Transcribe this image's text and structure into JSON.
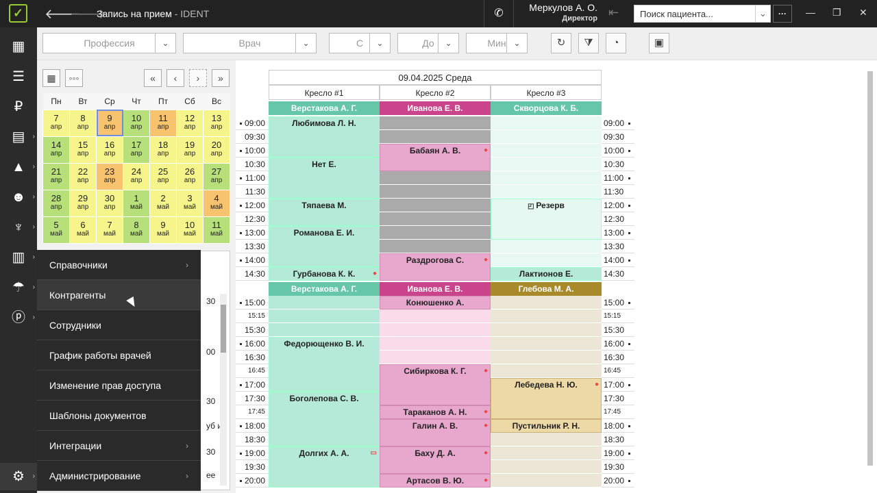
{
  "app": {
    "title": "Запись на прием",
    "subtitle": " - IDENT",
    "user_name": "Меркулов А. О.",
    "user_role": "Директор",
    "search_placeholder": "Поиск пациента...",
    "logo": "check-icon",
    "accent": "#99cc33"
  },
  "toolbar": {
    "profession": "Профессия",
    "doctor": "Врач",
    "from": "С",
    "to": "До",
    "min": "Мин"
  },
  "calendar": {
    "weekdays": [
      "Пн",
      "Вт",
      "Ср",
      "Чт",
      "Пт",
      "Сб",
      "Вс"
    ],
    "weeks": [
      [
        {
          "d": "7",
          "m": "апр",
          "c": "y"
        },
        {
          "d": "8",
          "m": "апр",
          "c": "y"
        },
        {
          "d": "9",
          "m": "апр",
          "c": "o",
          "sel": true
        },
        {
          "d": "10",
          "m": "апр",
          "c": "g"
        },
        {
          "d": "11",
          "m": "апр",
          "c": "o"
        },
        {
          "d": "12",
          "m": "апр",
          "c": "y"
        },
        {
          "d": "13",
          "m": "апр",
          "c": "y"
        }
      ],
      [
        {
          "d": "14",
          "m": "апр",
          "c": "g"
        },
        {
          "d": "15",
          "m": "апр",
          "c": "y"
        },
        {
          "d": "16",
          "m": "апр",
          "c": "y"
        },
        {
          "d": "17",
          "m": "апр",
          "c": "g"
        },
        {
          "d": "18",
          "m": "апр",
          "c": "y"
        },
        {
          "d": "19",
          "m": "апр",
          "c": "y"
        },
        {
          "d": "20",
          "m": "апр",
          "c": "y"
        }
      ],
      [
        {
          "d": "21",
          "m": "апр",
          "c": "g"
        },
        {
          "d": "22",
          "m": "апр",
          "c": "y"
        },
        {
          "d": "23",
          "m": "апр",
          "c": "o"
        },
        {
          "d": "24",
          "m": "апр",
          "c": "y"
        },
        {
          "d": "25",
          "m": "апр",
          "c": "y"
        },
        {
          "d": "26",
          "m": "апр",
          "c": "y"
        },
        {
          "d": "27",
          "m": "апр",
          "c": "g"
        }
      ],
      [
        {
          "d": "28",
          "m": "апр",
          "c": "g"
        },
        {
          "d": "29",
          "m": "апр",
          "c": "y"
        },
        {
          "d": "30",
          "m": "апр",
          "c": "y"
        },
        {
          "d": "1",
          "m": "май",
          "c": "g"
        },
        {
          "d": "2",
          "m": "май",
          "c": "y"
        },
        {
          "d": "3",
          "m": "май",
          "c": "y"
        },
        {
          "d": "4",
          "m": "май",
          "c": "o"
        }
      ],
      [
        {
          "d": "5",
          "m": "май",
          "c": "g"
        },
        {
          "d": "6",
          "m": "май",
          "c": "y"
        },
        {
          "d": "7",
          "m": "май",
          "c": "y"
        },
        {
          "d": "8",
          "m": "май",
          "c": "g"
        },
        {
          "d": "9",
          "m": "май",
          "c": "y"
        },
        {
          "d": "10",
          "m": "май",
          "c": "y"
        },
        {
          "d": "11",
          "m": "май",
          "c": "g"
        }
      ]
    ]
  },
  "side_list": {
    "times": [
      "30",
      "00",
      "30",
      "30"
    ],
    "fragments": [
      "уб и",
      "ее"
    ]
  },
  "menu": [
    {
      "label": "Справочники",
      "sub": true
    },
    {
      "label": "Контрагенты",
      "sub": false,
      "hover": true
    },
    {
      "label": "Сотрудники",
      "sub": false
    },
    {
      "label": "График работы врачей",
      "sub": false
    },
    {
      "label": "Изменение прав доступа",
      "sub": false
    },
    {
      "label": "Шаблоны документов",
      "sub": false
    },
    {
      "label": "Интеграции",
      "sub": true
    },
    {
      "label": "Администрирование",
      "sub": true
    }
  ],
  "schedule": {
    "date": "09.04.2025 Среда",
    "chairs": [
      "Кресло #1",
      "Кресло #2",
      "Кресло #3"
    ],
    "times_top": [
      "09:00",
      "09:30",
      "10:00",
      "10:30",
      "11:00",
      "11:30",
      "12:00",
      "12:30",
      "13:00",
      "13:30",
      "14:00",
      "14:30"
    ],
    "times_bottom": [
      "15:00",
      "15:15",
      "15:30",
      "16:00",
      "16:30",
      "16:45",
      "17:00",
      "17:30",
      "17:45",
      "18:00",
      "18:30",
      "19:00",
      "19:30",
      "20:00"
    ],
    "doctors_top": [
      {
        "name": "Верстакова А. Г.",
        "color": "#66c7a8"
      },
      {
        "name": "Иванова Е. В.",
        "color": "#c9448a"
      },
      {
        "name": "Скворцова К. Б.",
        "color": "#66c7a8"
      }
    ],
    "doctors_bottom": [
      {
        "name": "Верстакова А. Г.",
        "color": "#66c7a8"
      },
      {
        "name": "Иванова Е. В.",
        "color": "#c9448a"
      },
      {
        "name": "Глебова М. А.",
        "color": "#a88a2a"
      }
    ],
    "appointments": [
      {
        "col": 0,
        "part": "top",
        "start": 0,
        "len": 3,
        "name": "Любимова Л. Н.",
        "bg": "#b5ead9"
      },
      {
        "col": 0,
        "part": "top",
        "start": 3,
        "len": 3,
        "name": "Нет Е.",
        "bg": "#b5ead9"
      },
      {
        "col": 0,
        "part": "top",
        "start": 6,
        "len": 2,
        "name": "Тяпаева М.",
        "bg": "#b5ead9"
      },
      {
        "col": 0,
        "part": "top",
        "start": 8,
        "len": 3,
        "name": "Романова Е. И.",
        "bg": "#b5ead9"
      },
      {
        "col": 0,
        "part": "top",
        "start": 11,
        "len": 1,
        "name": "Гурбанова К. К.",
        "bg": "#b5ead9",
        "icon": "person-icon"
      },
      {
        "col": 1,
        "part": "top",
        "start": 2,
        "len": 2,
        "name": "Бабаян А. В.",
        "bg": "#e8a8cd",
        "icon": "person-icon"
      },
      {
        "col": 1,
        "part": "top",
        "start": 10,
        "len": 2,
        "name": "Раздрогова С.",
        "bg": "#e8a8cd",
        "icon": "person-icon"
      },
      {
        "col": 2,
        "part": "top",
        "start": 6,
        "len": 3,
        "name": "Резерв",
        "bg": "#e6f8f2",
        "icon": "reserve-icon"
      },
      {
        "col": 2,
        "part": "top",
        "start": 11,
        "len": 1,
        "name": "Лактионов Е.",
        "bg": "#b5ead9"
      },
      {
        "col": 0,
        "part": "bottom",
        "start": 3,
        "len": 4,
        "name": "Федорющенко В. И.",
        "bg": "#b5ead9"
      },
      {
        "col": 0,
        "part": "bottom",
        "start": 7,
        "len": 4,
        "name": "Боголепова С. В.",
        "bg": "#b5ead9"
      },
      {
        "col": 0,
        "part": "bottom",
        "start": 11,
        "len": 3,
        "name": "Долгих А. А.",
        "bg": "#b5ead9",
        "icon": "message-icon"
      },
      {
        "col": 1,
        "part": "bottom",
        "start": 0,
        "len": 1,
        "name": "Конюшенко А.",
        "bg": "#e8a8cd"
      },
      {
        "col": 1,
        "part": "bottom",
        "start": 5,
        "len": 3,
        "name": "Сибиркова К. Г.",
        "bg": "#e8a8cd",
        "icon": "person-icon"
      },
      {
        "col": 1,
        "part": "bottom",
        "start": 8,
        "len": 1,
        "name": "Тараканов А. Н.",
        "bg": "#e8a8cd",
        "icon": "person-icon"
      },
      {
        "col": 1,
        "part": "bottom",
        "start": 9,
        "len": 2,
        "name": "Галин А. В.",
        "bg": "#e8a8cd",
        "icon": "person-icon"
      },
      {
        "col": 1,
        "part": "bottom",
        "start": 11,
        "len": 2,
        "name": "Баху Д. А.",
        "bg": "#e8a8cd",
        "icon": "person-icon"
      },
      {
        "col": 1,
        "part": "bottom",
        "start": 13,
        "len": 1,
        "name": "Артасов В. Ю.",
        "bg": "#e8a8cd",
        "icon": "person-icon"
      },
      {
        "col": 2,
        "part": "bottom",
        "start": 6,
        "len": 3,
        "name": "Лебедева Н. Ю.",
        "bg": "#ecd9a6",
        "icon": "person-icon"
      },
      {
        "col": 2,
        "part": "bottom",
        "start": 9,
        "len": 1,
        "name": "Пустильник Р. Н.",
        "bg": "#ecd9a6"
      }
    ]
  }
}
